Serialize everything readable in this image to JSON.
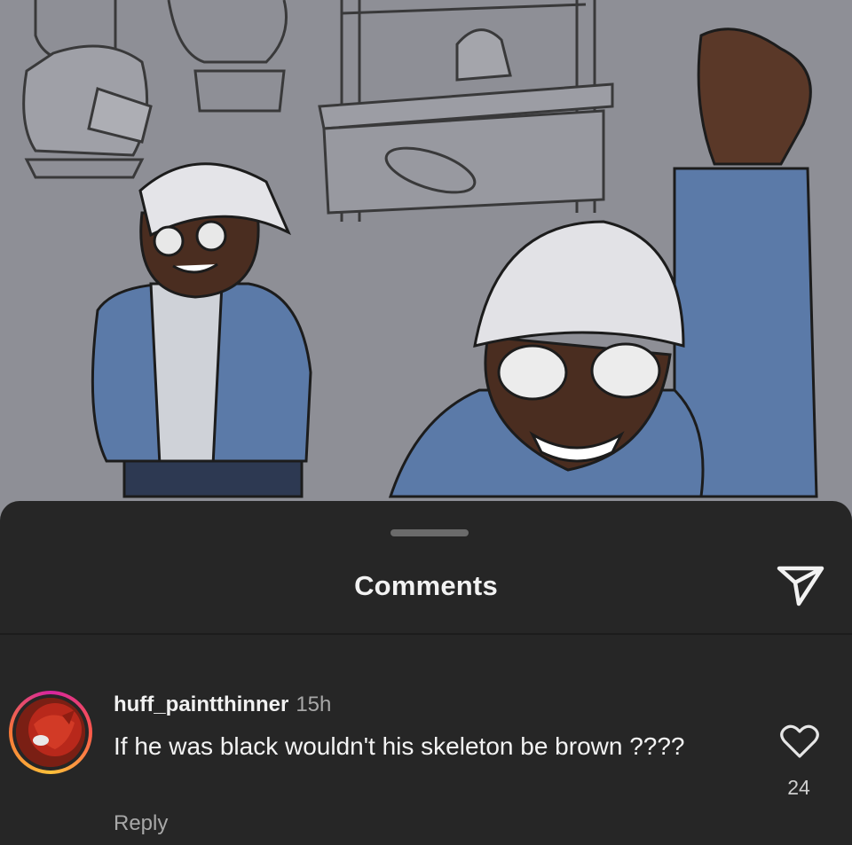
{
  "sheet": {
    "title": "Comments"
  },
  "icons": {
    "share": "send-icon",
    "like": "heart-icon"
  },
  "comment": {
    "username": "huff_paintthinner",
    "time": "15h",
    "text": "If he was black wouldn't his skeleton be brown ????",
    "reply_label": "Reply",
    "like_count": "24"
  },
  "colors": {
    "sheet_background": "#262626",
    "artwork_background": "#8e8f96",
    "avatar_ring": "#d6249f"
  }
}
